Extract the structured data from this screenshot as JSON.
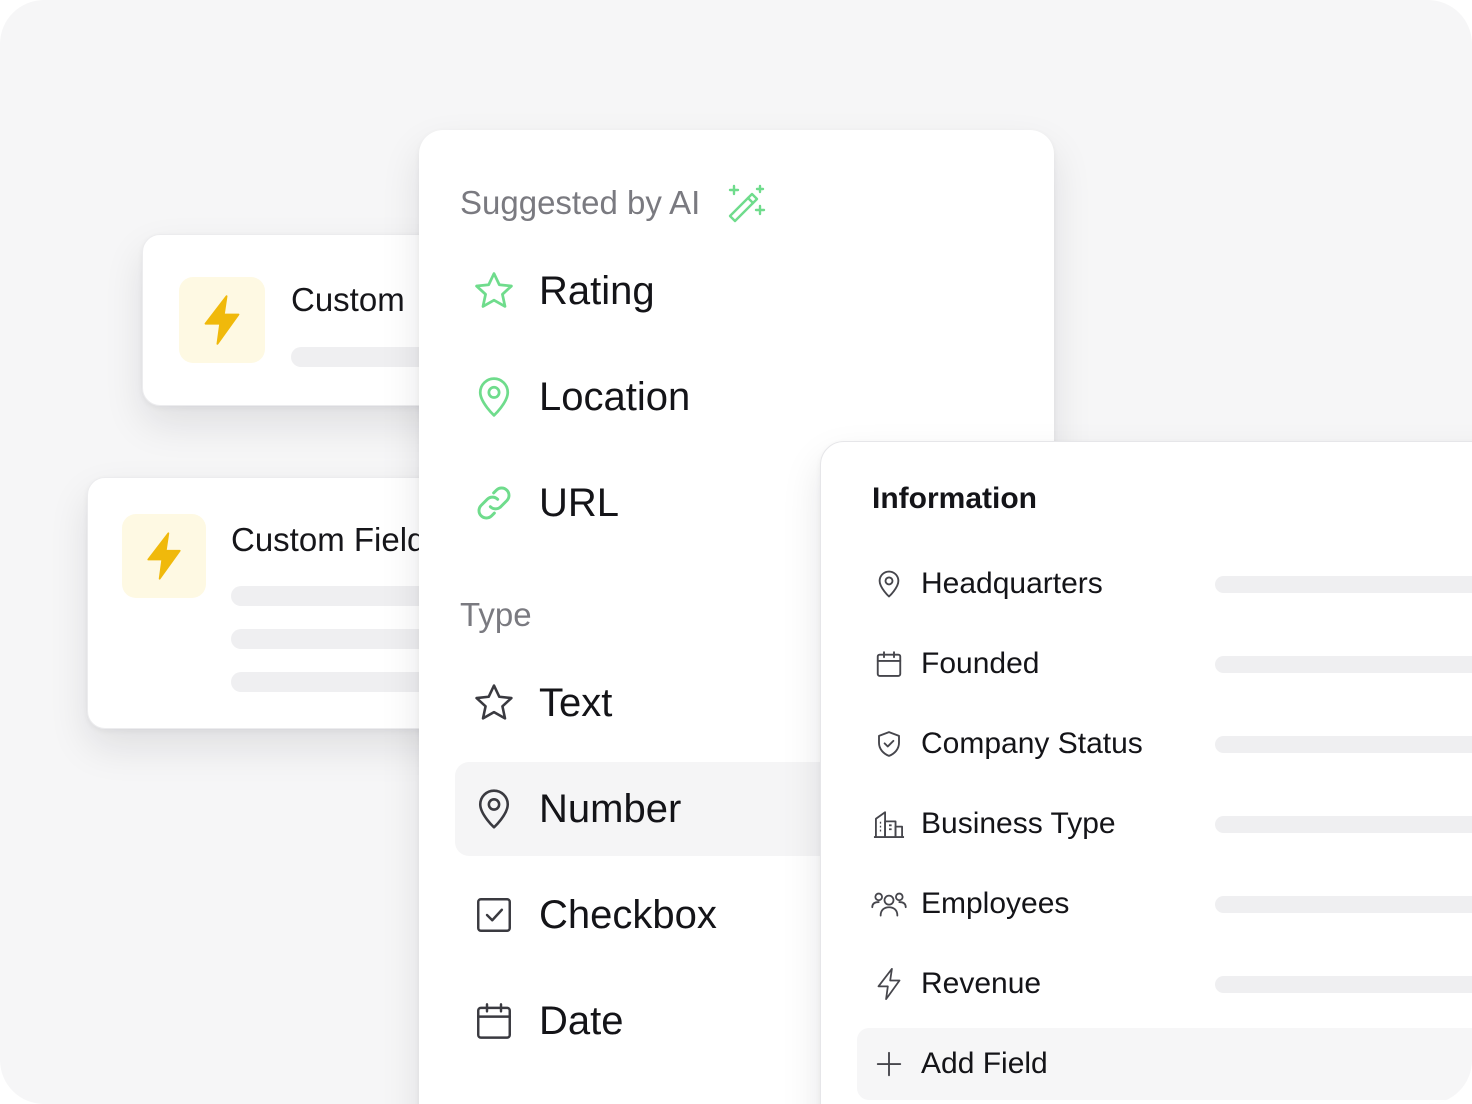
{
  "card_back": {
    "title": "Custom"
  },
  "card_front": {
    "title": "Custom Field"
  },
  "dropdown": {
    "ai_section": {
      "title": "Suggested by AI",
      "icon": "magic-wand-icon"
    },
    "ai_options": [
      {
        "label": "Rating",
        "icon": "star-icon"
      },
      {
        "label": "Location",
        "icon": "map-pin-icon"
      },
      {
        "label": "URL",
        "icon": "link-icon"
      }
    ],
    "type_section": {
      "title": "Type"
    },
    "type_options": [
      {
        "label": "Text",
        "icon": "star-icon"
      },
      {
        "label": "Number",
        "icon": "map-pin-icon",
        "selected": true
      },
      {
        "label": "Checkbox",
        "icon": "checkbox-icon"
      },
      {
        "label": "Date",
        "icon": "calendar-icon"
      }
    ]
  },
  "info_panel": {
    "title": "Information",
    "fields": [
      {
        "label": "Headquarters",
        "icon": "map-pin-icon"
      },
      {
        "label": "Founded",
        "icon": "calendar-icon"
      },
      {
        "label": "Company Status",
        "icon": "shield-check-icon"
      },
      {
        "label": "Business Type",
        "icon": "building-icon"
      },
      {
        "label": "Employees",
        "icon": "users-icon"
      },
      {
        "label": "Revenue",
        "icon": "lightning-icon"
      }
    ],
    "add_label": "Add Field"
  },
  "colors": {
    "ai_accent": "#6fdc8c",
    "bolt": "#f0b90b",
    "bolt_bg": "#fef9e3",
    "text": "#141418",
    "muted": "#7a7a80"
  }
}
